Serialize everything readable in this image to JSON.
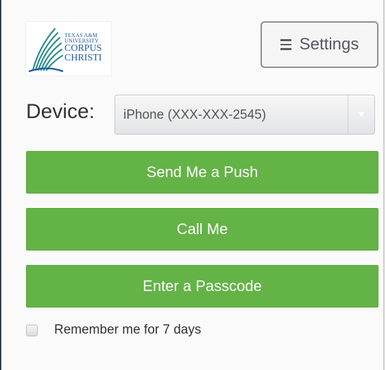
{
  "logo": {
    "line1": "TEXAS A&M",
    "line2": "UNIVERSITY",
    "line3": "CORPUS",
    "line4": "CHRISTI",
    "color": "#1f5aa6",
    "wing_color": "#2a8f8a"
  },
  "settings": {
    "label": "Settings",
    "icon": "menu-icon"
  },
  "device": {
    "label": "Device:",
    "selected": "iPhone (XXX-XXX-2545)",
    "dropdown_icon": "chevron-down-icon"
  },
  "actions": {
    "push": "Send Me a Push",
    "call": "Call Me",
    "passcode": "Enter a Passcode"
  },
  "remember": {
    "label": "Remember me for 7 days",
    "checked": false
  },
  "colors": {
    "accent": "#64b346",
    "text": "#333333"
  }
}
